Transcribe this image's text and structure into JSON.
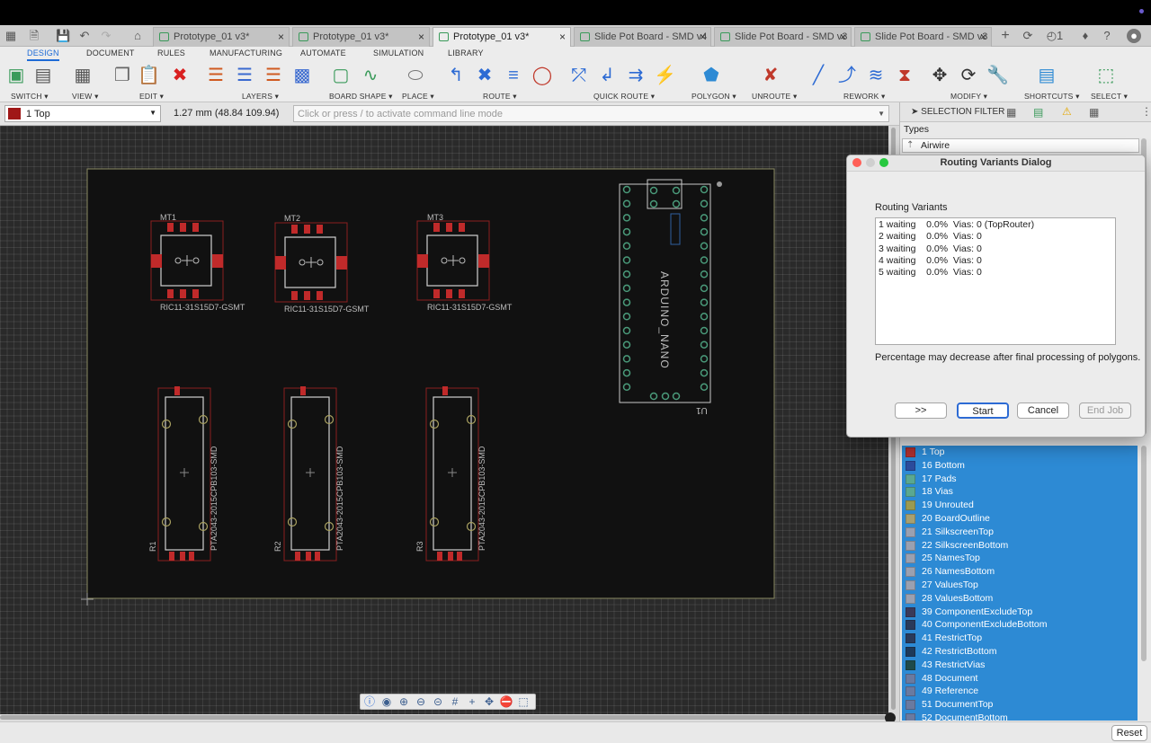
{
  "window": {
    "tabs": [
      {
        "title": "Prototype_01 v3*",
        "active": false
      },
      {
        "title": "Prototype_01 v3*",
        "active": false
      },
      {
        "title": "Prototype_01 v3*",
        "active": true
      },
      {
        "title": "Slide Pot Board - SMD v4",
        "active": false
      },
      {
        "title": "Slide Pot Board - SMD v3",
        "active": false
      },
      {
        "title": "Slide Pot Board - SMD v3",
        "active": false
      }
    ],
    "notifications_count": "1"
  },
  "ribbon": {
    "tabs": [
      "DESIGN",
      "DOCUMENT",
      "RULES",
      "MANUFACTURING",
      "AUTOMATE",
      "SIMULATION",
      "LIBRARY"
    ],
    "groups": [
      "SWITCH",
      "VIEW",
      "EDIT",
      "LAYERS",
      "BOARD SHAPE",
      "PLACE",
      "ROUTE",
      "QUICK ROUTE",
      "POLYGON",
      "UNROUTE",
      "REWORK",
      "MODIFY",
      "SHORTCUTS",
      "SELECT"
    ]
  },
  "command": {
    "layer": "1 Top",
    "coords": "1.27 mm (48.84 109.94)",
    "placeholder": "Click or press / to activate command line mode"
  },
  "selection_filter": {
    "title": "SELECTION FILTER",
    "types_label": "Types",
    "first_type": "Airwire"
  },
  "board": {
    "switches": [
      {
        "ref": "MT1",
        "value": "RIC11-31S15D7-GSMT"
      },
      {
        "ref": "MT2",
        "value": "RIC11-31S15D7-GSMT"
      },
      {
        "ref": "MT3",
        "value": "RIC11-31S15D7-GSMT"
      }
    ],
    "pots": [
      {
        "ref": "R1",
        "value": "PTA2043-2015CPB103-SMD"
      },
      {
        "ref": "R2",
        "value": "PTA2043-2015CPB103-SMD"
      },
      {
        "ref": "R3",
        "value": "PTA2043-2015CPB103-SMD"
      }
    ],
    "module": {
      "ref": "U1",
      "value": "ARDUINO_NANO"
    }
  },
  "dialog": {
    "title": "Routing Variants Dialog",
    "section_label": "Routing Variants",
    "variants": [
      "1 waiting    0.0%  Vias: 0 (TopRouter)",
      "2 waiting    0.0%  Vias: 0",
      "3 waiting    0.0%  Vias: 0",
      "4 waiting    0.0%  Vias: 0",
      "5 waiting    0.0%  Vias: 0"
    ],
    "note": "Percentage may decrease after final processing of polygons.",
    "buttons": {
      "more": ">>",
      "start": "Start",
      "cancel": "Cancel",
      "end_job": "End Job"
    }
  },
  "layers": [
    {
      "name": "1 Top",
      "color": "#b03030"
    },
    {
      "name": "16 Bottom",
      "color": "#2c4c9c"
    },
    {
      "name": "17 Pads",
      "color": "#5aa890"
    },
    {
      "name": "18 Vias",
      "color": "#5aa890"
    },
    {
      "name": "19 Unrouted",
      "color": "#9a9a50"
    },
    {
      "name": "20 BoardOutline",
      "color": "#a8a070"
    },
    {
      "name": "21 SilkscreenTop",
      "color": "#9aa0b0"
    },
    {
      "name": "22 SilkscreenBottom",
      "color": "#9aa0b0"
    },
    {
      "name": "25 NamesTop",
      "color": "#9aa0b0"
    },
    {
      "name": "26 NamesBottom",
      "color": "#9aa0b0"
    },
    {
      "name": "27 ValuesTop",
      "color": "#9aa0b0"
    },
    {
      "name": "28 ValuesBottom",
      "color": "#9aa0b0"
    },
    {
      "name": "39 ComponentExcludeTop",
      "color": "#3a3a5a"
    },
    {
      "name": "40 ComponentExcludeBottom",
      "color": "#2a3a5a"
    },
    {
      "name": "41 RestrictTop",
      "color": "#2a3a5a"
    },
    {
      "name": "42 RestrictBottom",
      "color": "#1e3a5a"
    },
    {
      "name": "43 RestrictVias",
      "color": "#1e4a4a"
    },
    {
      "name": "48 Document",
      "color": "#6a7aa0"
    },
    {
      "name": "49 Reference",
      "color": "#6a7aa0"
    },
    {
      "name": "51 DocumentTop",
      "color": "#6a7aa0"
    },
    {
      "name": "52 DocumentBottom",
      "color": "#6a7aa0"
    }
  ],
  "panel_footer": {
    "reset": "Reset"
  }
}
